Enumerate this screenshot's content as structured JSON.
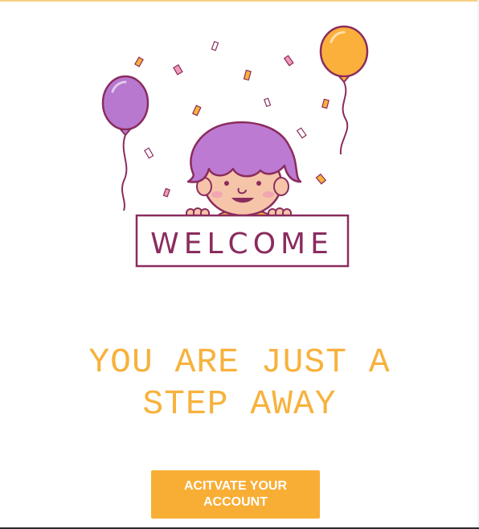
{
  "illustration": {
    "sign_text": "WELCOME",
    "colors": {
      "balloon_left": "#b878cf",
      "balloon_right": "#fbb03b",
      "outline": "#8a2d5e",
      "hair": "#bd7ad3",
      "skin": "#f6c4a8"
    }
  },
  "headline": {
    "line1": "YOU ARE JUST A",
    "line2": "STEP AWAY",
    "color": "#f6b23c"
  },
  "cta": {
    "label": "ACITVATE YOUR ACCOUNT",
    "color": "#f8ad34"
  }
}
